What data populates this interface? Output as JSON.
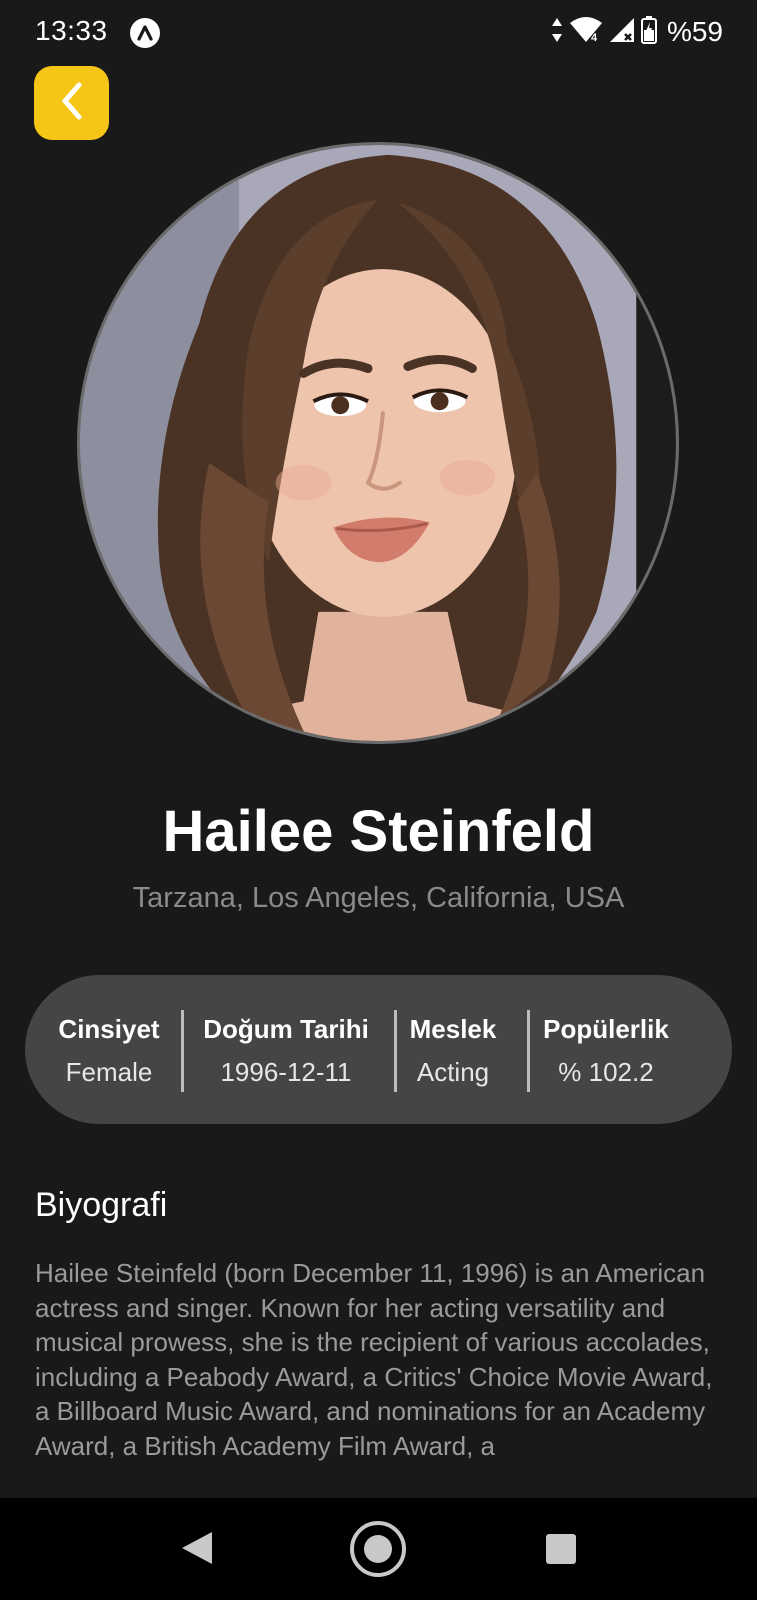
{
  "status_bar": {
    "time": "13:33",
    "battery": "%59",
    "icons": [
      "app-notification-icon",
      "data-arrows-icon",
      "wifi-icon",
      "signal-icon",
      "battery-charging-icon"
    ]
  },
  "header": {
    "back_icon": "chevron-left-icon",
    "accent_color": "#f5c518"
  },
  "profile": {
    "name": "Hailee Steinfeld",
    "birth_place": "Tarzana, Los Angeles, California, USA"
  },
  "info": {
    "gender_label": "Cinsiyet",
    "gender_value": "Female",
    "birthday_label": "Doğum Tarihi",
    "birthday_value": "1996-12-11",
    "job_label": "Meslek",
    "job_value": "Acting",
    "popularity_label": "Popülerlik",
    "popularity_value": "% 102.2"
  },
  "biography": {
    "title": "Biyografi",
    "text": "Hailee Steinfeld (born December 11, 1996) is an American actress and singer. Known for her acting versatility and musical prowess, she is the recipient of various accolades, including a Peabody Award, a Critics' Choice Movie Award, a Billboard Music Award, and nominations for an Academy Award, a British Academy Film Award, a"
  },
  "nav_bar": {
    "icons": [
      "back-triangle-icon",
      "home-circle-icon",
      "recents-square-icon"
    ]
  }
}
